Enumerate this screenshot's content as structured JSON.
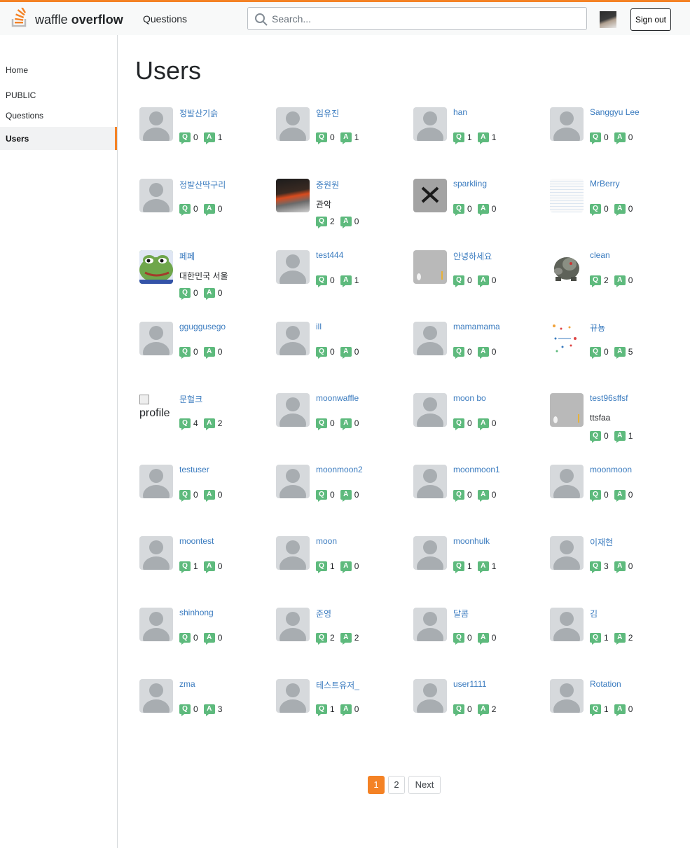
{
  "header": {
    "brand_light": "waffle ",
    "brand_bold": "overflow",
    "nav_questions": "Questions",
    "search_placeholder": "Search...",
    "signout_label": "Sign out",
    "accent_color": "#f48225"
  },
  "sidebar": {
    "home": "Home",
    "public_heading": "PUBLIC",
    "questions": "Questions",
    "users": "Users"
  },
  "main": {
    "title": "Users"
  },
  "badges": {
    "question": "Q",
    "answer": "A"
  },
  "users": [
    {
      "name": "정발산기슭",
      "q": 0,
      "a": 1,
      "avatar": "default"
    },
    {
      "name": "임유진",
      "q": 0,
      "a": 1,
      "avatar": "default"
    },
    {
      "name": "han",
      "q": 1,
      "a": 1,
      "avatar": "default"
    },
    {
      "name": "Sanggyu Lee",
      "q": 0,
      "a": 0,
      "avatar": "default"
    },
    {
      "name": "정발산딱구리",
      "q": 0,
      "a": 0,
      "avatar": "default"
    },
    {
      "name": "중원원",
      "location": "관악",
      "q": 2,
      "a": 0,
      "avatar": "dark-photo"
    },
    {
      "name": "sparkling",
      "q": 0,
      "a": 0,
      "avatar": "x-mark"
    },
    {
      "name": "MrBerry",
      "q": 0,
      "a": 0,
      "avatar": "document"
    },
    {
      "name": "페페",
      "location": "대한민국 서울",
      "q": 0,
      "a": 0,
      "avatar": "frog"
    },
    {
      "name": "test444",
      "q": 0,
      "a": 1,
      "avatar": "default"
    },
    {
      "name": "안녕하세요",
      "q": 0,
      "a": 0,
      "avatar": "gray-photo"
    },
    {
      "name": "clean",
      "q": 2,
      "a": 0,
      "avatar": "creature"
    },
    {
      "name": "gguggusego",
      "q": 0,
      "a": 0,
      "avatar": "default"
    },
    {
      "name": "ill",
      "q": 0,
      "a": 0,
      "avatar": "default"
    },
    {
      "name": "mamamama",
      "q": 0,
      "a": 0,
      "avatar": "default"
    },
    {
      "name": "뀨뇽",
      "q": 0,
      "a": 5,
      "avatar": "diagram"
    },
    {
      "name": "문헐크",
      "q": 4,
      "a": 2,
      "avatar": "broken",
      "alt": "profile"
    },
    {
      "name": "moonwaffle",
      "q": 0,
      "a": 0,
      "avatar": "default"
    },
    {
      "name": "moon bo",
      "q": 0,
      "a": 0,
      "avatar": "default"
    },
    {
      "name": "test96sffsf",
      "location": "ttsfaa",
      "q": 0,
      "a": 1,
      "avatar": "gray-photo"
    },
    {
      "name": "testuser",
      "q": 0,
      "a": 0,
      "avatar": "default"
    },
    {
      "name": "moonmoon2",
      "q": 0,
      "a": 0,
      "avatar": "default"
    },
    {
      "name": "moonmoon1",
      "q": 0,
      "a": 0,
      "avatar": "default"
    },
    {
      "name": "moonmoon",
      "q": 0,
      "a": 0,
      "avatar": "default"
    },
    {
      "name": "moontest",
      "q": 1,
      "a": 0,
      "avatar": "default"
    },
    {
      "name": "moon",
      "q": 1,
      "a": 0,
      "avatar": "default"
    },
    {
      "name": "moonhulk",
      "q": 1,
      "a": 1,
      "avatar": "default"
    },
    {
      "name": "이재현",
      "q": 3,
      "a": 0,
      "avatar": "default"
    },
    {
      "name": "shinhong",
      "q": 0,
      "a": 0,
      "avatar": "default"
    },
    {
      "name": "준영",
      "q": 2,
      "a": 2,
      "avatar": "default"
    },
    {
      "name": "달콤",
      "q": 0,
      "a": 0,
      "avatar": "default"
    },
    {
      "name": "김",
      "q": 1,
      "a": 2,
      "avatar": "default"
    },
    {
      "name": "zma",
      "q": 0,
      "a": 3,
      "avatar": "default"
    },
    {
      "name": "테스트유저_",
      "q": 1,
      "a": 0,
      "avatar": "default"
    },
    {
      "name": "user1111",
      "q": 0,
      "a": 2,
      "avatar": "default"
    },
    {
      "name": "Rotation",
      "q": 1,
      "a": 0,
      "avatar": "default"
    }
  ],
  "pagination": {
    "pages": [
      "1",
      "2"
    ],
    "current": "1",
    "next_label": "Next"
  }
}
